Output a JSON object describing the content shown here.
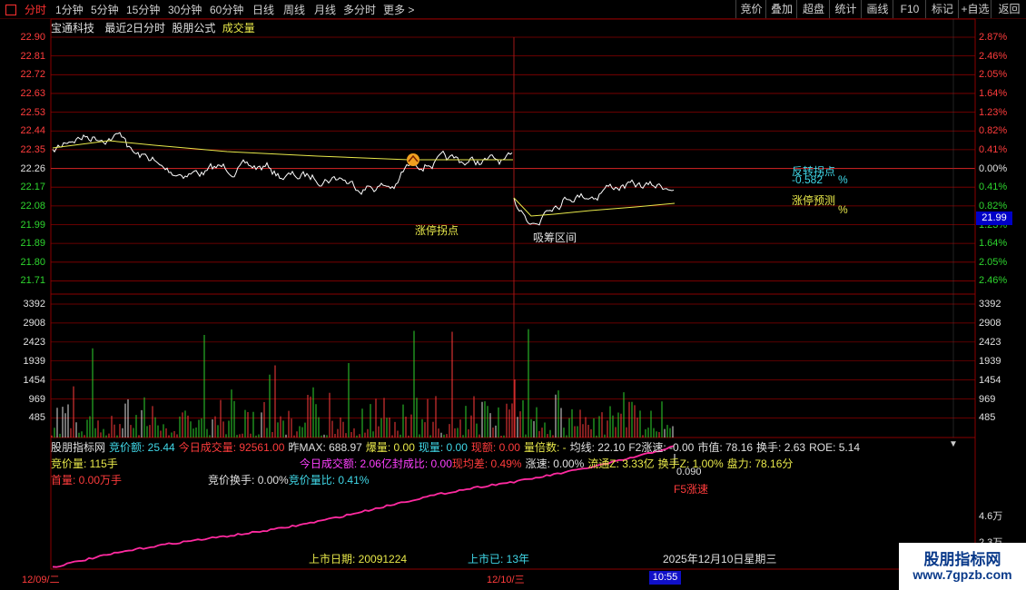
{
  "toolbar": {
    "tabs": [
      "分时",
      "1分钟",
      "5分钟",
      "15分钟",
      "30分钟",
      "60分钟",
      "日线",
      "周线",
      "月线",
      "多分时",
      "更多"
    ],
    "more_arrow": ">",
    "right_buttons": [
      "竞价",
      "叠加",
      "超盘",
      "统计",
      "画线",
      "F10",
      "标记",
      "+自选",
      "返回"
    ]
  },
  "info": {
    "stock_name": "宝通科技",
    "mode": "最近2日分时",
    "formula_label": "股朋公式",
    "volume_label": "成交量"
  },
  "price_axis": {
    "left": [
      "22.90",
      "22.81",
      "22.72",
      "22.63",
      "22.53",
      "22.44",
      "22.35",
      "22.26",
      "22.17",
      "22.08",
      "21.99",
      "21.89",
      "21.80",
      "21.71"
    ],
    "right": [
      "2.87%",
      "2.46%",
      "2.05%",
      "1.64%",
      "1.23%",
      "0.82%",
      "0.41%",
      "0.00%",
      "0.41%",
      "0.82%",
      "1.23%",
      "1.64%",
      "2.05%",
      "2.46%"
    ],
    "current_price": "21.99"
  },
  "volume_axis": [
    "3392",
    "2908",
    "2423",
    "1939",
    "1454",
    "969",
    "485"
  ],
  "annotations": {
    "limit_up_turn": "涨停拐点",
    "accumulate_zone": "吸筹区间",
    "reversal_point": "反转拐点",
    "reversal_value": "-0.582",
    "reversal_pct": "%",
    "limit_up_forecast": "涨停预测",
    "forecast_pct": "%"
  },
  "indicator": {
    "row1": [
      {
        "text": "股朋指标网",
        "color": "#e0e0e0"
      },
      {
        "text": "竞价额: 25.44",
        "color": "#40d8e8"
      },
      {
        "text": "今日成交量: 92561.00",
        "color": "#ff3c3c"
      },
      {
        "text": "昨MAX: 688.97",
        "color": "#e0e0e0"
      },
      {
        "text": "爆量: 0.00",
        "color": "#e8e84a"
      },
      {
        "text": "现量: 0.00",
        "color": "#40d8e8"
      },
      {
        "text": "现额: 0.00",
        "color": "#ff3c3c"
      },
      {
        "text": "量倍数: -",
        "color": "#e8e84a"
      },
      {
        "text": "均线: 22.10",
        "color": "#e0e0e0"
      },
      {
        "text": "F2涨速: -0.00",
        "color": "#e0e0e0"
      },
      {
        "text": "市值: 78.16",
        "color": "#e0e0e0"
      },
      {
        "text": "换手: 2.63",
        "color": "#e0e0e0"
      },
      {
        "text": "ROE: 5.14",
        "color": "#e0e0e0"
      }
    ],
    "row2": [
      {
        "text": "竞价量: 115手",
        "color": "#e8e84a"
      },
      {
        "text": "今日成交额: 2.06亿",
        "color": "#ff40ff"
      },
      {
        "text": "封成比: 0.00",
        "color": "#ff40ff"
      },
      {
        "text": "现均差: 0.49%",
        "color": "#ff3c3c"
      },
      {
        "text": "涨速: 0.00%",
        "color": "#e0e0e0"
      },
      {
        "text": "流通Z: 3.33亿",
        "color": "#e8e84a"
      },
      {
        "text": "换手Z: 1.00%",
        "color": "#e8e84a"
      },
      {
        "text": "盘力: 78.16分",
        "color": "#e8e84a"
      }
    ],
    "row3": [
      {
        "text": "首量: 0.00万手",
        "color": "#ff3c3c"
      },
      {
        "text": "竞价换手: 0.00%",
        "color": "#e0e0e0"
      },
      {
        "text": "竞价量比: 0.41%",
        "color": "#40d8e8"
      }
    ],
    "speed_value": "0.090",
    "speed_label": "F5涨速",
    "axis_top": "4.6万",
    "axis_bottom": "2.3万",
    "list_date": "上市日期: 20091224",
    "listed_years": "上市已: 13年",
    "today": "2025年12月10日星期三"
  },
  "time_axis": {
    "day1": "12/09/二",
    "day2": "12/10/三",
    "cursor_time": "10:55"
  },
  "watermark": {
    "title": "股朋指标网",
    "url": "www.7gpzb.com"
  },
  "colors": {
    "grid_red": "#8a0000",
    "price_line": "#ffffff",
    "avg_line": "#e8e84a",
    "vol_up": "#ff3c3c",
    "vol_down": "#2ed52e",
    "vol_flat": "#e0e0e0",
    "cum_line": "#ff2aa0"
  }
}
